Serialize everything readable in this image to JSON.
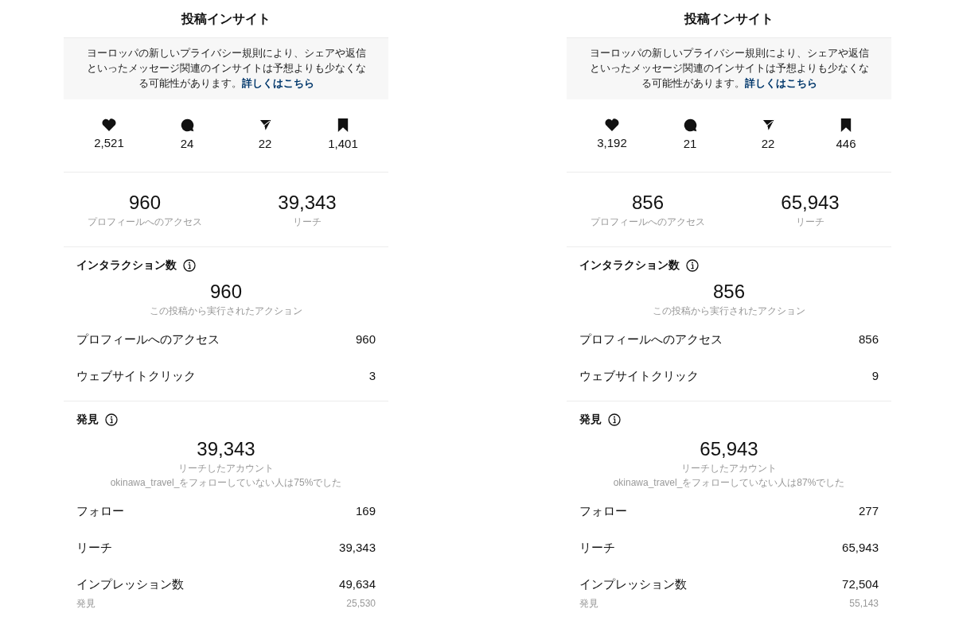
{
  "panels": [
    {
      "title": "投稿インサイト",
      "notice": {
        "text": "ヨーロッパの新しいプライバシー規則により、シェアや返信といったメッセージ関連のインサイトは予想よりも少なくなる可能性があります。",
        "link": "詳しくはこちら"
      },
      "stats": [
        {
          "kind": "like",
          "value": "2,521"
        },
        {
          "kind": "comment",
          "value": "24"
        },
        {
          "kind": "share",
          "value": "22"
        },
        {
          "kind": "save",
          "value": "1,401"
        }
      ],
      "summary": [
        {
          "value": "960",
          "label": "プロフィールへのアクセス"
        },
        {
          "value": "39,343",
          "label": "リーチ"
        }
      ],
      "interactions": {
        "title": "インタラクション数",
        "total": "960",
        "caption": "この投稿から実行されたアクション",
        "rows": [
          {
            "label": "プロフィールへのアクセス",
            "value": "960"
          },
          {
            "label": "ウェブサイトクリック",
            "value": "3"
          }
        ]
      },
      "discovery": {
        "title": "発見",
        "total": "39,343",
        "captions": [
          "リーチしたアカウント",
          "okinawa_travel_をフォローしていない人は75%でした"
        ],
        "rows": [
          {
            "label": "フォロー",
            "value": "169"
          },
          {
            "label": "リーチ",
            "value": "39,343"
          },
          {
            "label": "インプレッション数",
            "value": "49,634"
          }
        ],
        "sub_row": {
          "label": "発見",
          "value": "25,530"
        }
      }
    },
    {
      "title": "投稿インサイト",
      "notice": {
        "text": "ヨーロッパの新しいプライバシー規則により、シェアや返信といったメッセージ関連のインサイトは予想よりも少なくなる可能性があります。",
        "link": "詳しくはこちら"
      },
      "stats": [
        {
          "kind": "like",
          "value": "3,192"
        },
        {
          "kind": "comment",
          "value": "21"
        },
        {
          "kind": "share",
          "value": "22"
        },
        {
          "kind": "save",
          "value": "446"
        }
      ],
      "summary": [
        {
          "value": "856",
          "label": "プロフィールへのアクセス"
        },
        {
          "value": "65,943",
          "label": "リーチ"
        }
      ],
      "interactions": {
        "title": "インタラクション数",
        "total": "856",
        "caption": "この投稿から実行されたアクション",
        "rows": [
          {
            "label": "プロフィールへのアクセス",
            "value": "856"
          },
          {
            "label": "ウェブサイトクリック",
            "value": "9"
          }
        ]
      },
      "discovery": {
        "title": "発見",
        "total": "65,943",
        "captions": [
          "リーチしたアカウント",
          "okinawa_travel_をフォローしていない人は87%でした"
        ],
        "rows": [
          {
            "label": "フォロー",
            "value": "277"
          },
          {
            "label": "リーチ",
            "value": "65,943"
          },
          {
            "label": "インプレッション数",
            "value": "72,504"
          }
        ],
        "sub_row": {
          "label": "発見",
          "value": "55,143"
        }
      }
    }
  ]
}
